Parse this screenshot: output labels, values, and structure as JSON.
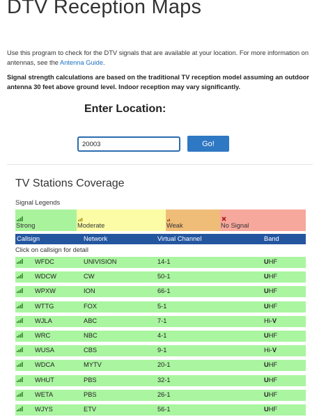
{
  "page": {
    "title": "DTV Reception Maps",
    "intro_text": "Use this program to check for the DTV signals that are available at your location. For more information on antennas, see the ",
    "intro_link": "Antenna Guide",
    "intro_end": ".",
    "note": "Signal strength calculations are based on the traditional TV reception model assuming an outdoor antenna 30 feet above ground level. Indoor reception may vary significantly."
  },
  "location": {
    "heading": "Enter Location:",
    "value": "20003",
    "button_label": "Go!"
  },
  "coverage": {
    "title": "TV Stations Coverage",
    "legend_title": "Signal Legends",
    "legends": [
      {
        "label": "Strong",
        "color": "#a9f39d",
        "icon": "signal-strong-icon"
      },
      {
        "label": "Moderate",
        "color": "#fcfca6",
        "icon": "signal-moderate-icon"
      },
      {
        "label": "Weak",
        "color": "#f0bd78",
        "icon": "signal-weak-icon"
      },
      {
        "label": "No Signal",
        "color": "#f7a89c",
        "icon": "no-signal-icon"
      }
    ],
    "headers": {
      "callsign": "Callsign",
      "network": "Network",
      "virtual_channel": "Virtual Channel",
      "band": "Band"
    },
    "hint": "Click on callsign for detail",
    "header_color": "#2456a0",
    "stations": [
      {
        "callsign": "WFDC",
        "network": "UNIVISION",
        "channel": "14-1",
        "band_bold": "U",
        "band_rest": "HF",
        "band_bold_first": true
      },
      {
        "callsign": "WDCW",
        "network": "CW",
        "channel": "50-1",
        "band_bold": "U",
        "band_rest": "HF",
        "band_bold_first": true
      },
      {
        "callsign": "WPXW",
        "network": "ION",
        "channel": "66-1",
        "band_bold": "U",
        "band_rest": "HF",
        "band_bold_first": true
      },
      {
        "callsign": "WTTG",
        "network": "FOX",
        "channel": "5-1",
        "band_bold": "U",
        "band_rest": "HF",
        "band_bold_first": true
      },
      {
        "callsign": "WJLA",
        "network": "ABC",
        "channel": "7-1",
        "band_bold": "V",
        "band_rest": "Hi-",
        "band_bold_first": false
      },
      {
        "callsign": "WRC",
        "network": "NBC",
        "channel": "4-1",
        "band_bold": "U",
        "band_rest": "HF",
        "band_bold_first": true
      },
      {
        "callsign": "WUSA",
        "network": "CBS",
        "channel": "9-1",
        "band_bold": "V",
        "band_rest": "Hi-",
        "band_bold_first": false
      },
      {
        "callsign": "WDCA",
        "network": "MYTV",
        "channel": "20-1",
        "band_bold": "U",
        "band_rest": "HF",
        "band_bold_first": true
      },
      {
        "callsign": "WHUT",
        "network": "PBS",
        "channel": "32-1",
        "band_bold": "U",
        "band_rest": "HF",
        "band_bold_first": true
      },
      {
        "callsign": "WETA",
        "network": "PBS",
        "channel": "26-1",
        "band_bold": "U",
        "band_rest": "HF",
        "band_bold_first": true
      },
      {
        "callsign": "WJYS",
        "network": "ETV",
        "channel": "56-1",
        "band_bold": "U",
        "band_rest": "HF",
        "band_bold_first": true
      }
    ]
  }
}
